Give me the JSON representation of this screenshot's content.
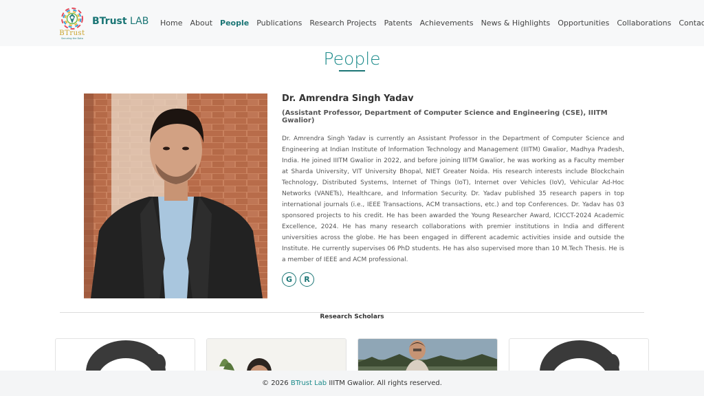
{
  "brand": {
    "name_bold": "BTrust",
    "name_light": "LAB",
    "logo_text": "BTrust",
    "logo_tagline": "Securing the Data"
  },
  "nav": {
    "items": [
      {
        "label": "Home",
        "active": false
      },
      {
        "label": "About",
        "active": false
      },
      {
        "label": "People",
        "active": true
      },
      {
        "label": "Publications",
        "active": false
      },
      {
        "label": "Research Projects",
        "active": false
      },
      {
        "label": "Patents",
        "active": false
      },
      {
        "label": "Achievements",
        "active": false
      },
      {
        "label": "News & Highlights",
        "active": false
      },
      {
        "label": "Opportunities",
        "active": false
      },
      {
        "label": "Collaborations",
        "active": false
      },
      {
        "label": "Contact",
        "active": false
      }
    ]
  },
  "page": {
    "title": "People"
  },
  "profile": {
    "name": "Dr. Amrendra Singh Yadav",
    "role": "(Assistant Professor, Department of Computer Science and Engineering (CSE), IIITM Gwalior)",
    "bio": "Dr. Amrendra Singh Yadav is currently an Assistant Professor in the Department of Computer Science and Engineering at Indian Institute of Information Technology and Management (IIITM) Gwalior, Madhya Pradesh, India. He joined IIITM Gwalior in 2022, and before joining IIITM Gwalior, he was working as a Faculty member at Sharda University, VIT University Bhopal, NIET Greater Noida. His research interests include Blockchain Technology, Distributed Systems, Internet of Things (IoT), Internet over Vehicles (IoV), Vehicular Ad-Hoc Networks (VANETs), Healthcare, and Information Security. Dr. Yadav published 35 research papers in top international journals (i.e., IEEE Transactions, ACM transactions, etc.) and top Conferences. Dr. Yadav has 03 sponsored projects to his credit. He has been awarded the Young Researcher Award, ICICCT-2024 Academic Excellence, 2024. He has many research collaborations with premier institutions in India and different universities across the globe. He has been engaged in different academic activities inside and outside the Institute. He currently supervises 06 PhD students. He has also supervised more than 10 M.Tech Thesis. He is a member of IEEE and ACM professional.",
    "social": [
      {
        "icon": "google-scholar-icon",
        "glyph": "G"
      },
      {
        "icon": "researchgate-icon",
        "glyph": "R"
      }
    ]
  },
  "scholars_section": {
    "title": "Research Scholars"
  },
  "footer": {
    "prefix": "© 2026",
    "brand": "BTrust Lab",
    "suffix": "IIITM Gwalior. All rights reserved."
  },
  "colors": {
    "accent": "#1a7575",
    "accent_light": "#1a8a8a",
    "logo_gold": "#c9a227",
    "navbar_bg": "#f7f8f9",
    "footer_bg": "#f4f5f6"
  }
}
